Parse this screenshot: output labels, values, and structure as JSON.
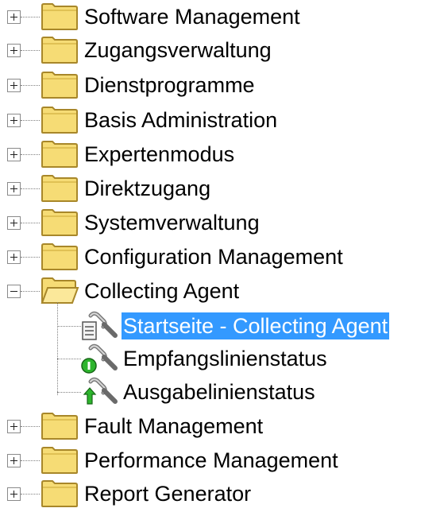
{
  "tree": {
    "top_items": [
      {
        "label": "Software Management",
        "expander": "+"
      },
      {
        "label": "Zugangsverwaltung",
        "expander": "+"
      },
      {
        "label": "Dienstprogramme",
        "expander": "+"
      },
      {
        "label": "Basis Administration",
        "expander": "+"
      },
      {
        "label": "Expertenmodus",
        "expander": "+"
      },
      {
        "label": "Direktzugang",
        "expander": "+"
      },
      {
        "label": "Systemverwaltung",
        "expander": "+"
      },
      {
        "label": "Configuration Management",
        "expander": "+"
      }
    ],
    "expanded_item": {
      "label": "Collecting Agent",
      "expander": "-"
    },
    "children": [
      {
        "label": "Startseite - Collecting Agent",
        "icon": "document-sound-icon",
        "selected": true
      },
      {
        "label": "Empfangslinienstatus",
        "icon": "receive-status-icon",
        "selected": false
      },
      {
        "label": "Ausgabelinienstatus",
        "icon": "output-status-icon",
        "selected": false
      }
    ],
    "bottom_items": [
      {
        "label": "Fault Management",
        "expander": "+"
      },
      {
        "label": "Performance Management",
        "expander": "+"
      },
      {
        "label": "Report Generator",
        "expander": "+"
      }
    ]
  },
  "colors": {
    "selection": "#3399ff",
    "folder": "#f6dc75",
    "folder_outline": "#a8872a"
  }
}
